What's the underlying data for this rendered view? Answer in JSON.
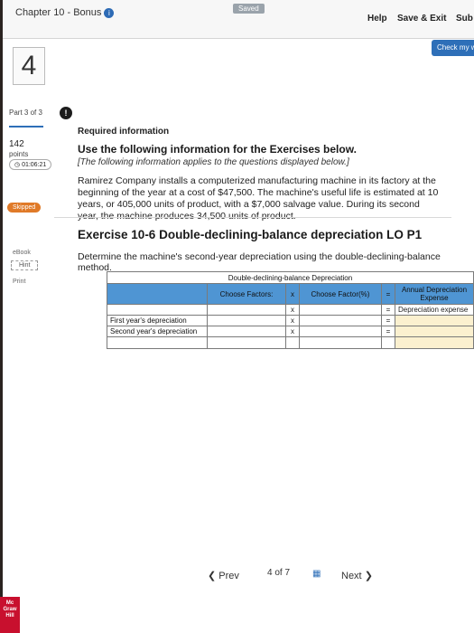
{
  "header": {
    "chapter": "Chapter 10 - Bonus",
    "saved": "Saved",
    "help": "Help",
    "save_exit": "Save & Exit",
    "submit": "Sub",
    "check_work": "Check my wo"
  },
  "sidebar": {
    "question_number": "4",
    "part": "Part 3 of 3",
    "points_value": "142",
    "points_label": "points",
    "timer": "01:06:21",
    "skipped": "Skipped",
    "ebook": "eBook",
    "hint": "Hint",
    "print": "Print",
    "logo": "Mc Graw Hill"
  },
  "content": {
    "info_icon": "!",
    "required": "Required information",
    "use_following": "Use the following information for the Exercises below.",
    "following_note": "[The following information applies to the questions displayed below.]",
    "paragraph": "Ramirez Company installs a computerized manufacturing machine in its factory at the beginning of the year at a cost of $47,500. The machine's useful life is estimated at 10 years, or 405,000 units of product, with a $7,000 salvage value. During its second year, the machine produces 34,500 units of product.",
    "exercise_title": "Exercise 10-6 Double-declining-balance depreciation LO P1",
    "determine": "Determine the machine's second-year depreciation using the double-declining-balance method."
  },
  "table": {
    "caption": "Double-declining-balance Depreciation",
    "col_factors": "Choose Factors:",
    "op_x": "x",
    "col_factor_pct": "Choose Factor(%)",
    "op_eq": "=",
    "col_annual": "Annual Depreciation Expense",
    "rows": [
      {
        "label": "",
        "op1": "x",
        "op2": "=",
        "result": "Depreciation expense"
      },
      {
        "label": "First year's depreciation",
        "op1": "x",
        "op2": "=",
        "result": ""
      },
      {
        "label": "Second year's depreciation",
        "op1": "x",
        "op2": "=",
        "result": ""
      }
    ]
  },
  "footer": {
    "prev": "Prev",
    "page_current": "4",
    "page_of": "of 7",
    "next": "Next"
  }
}
